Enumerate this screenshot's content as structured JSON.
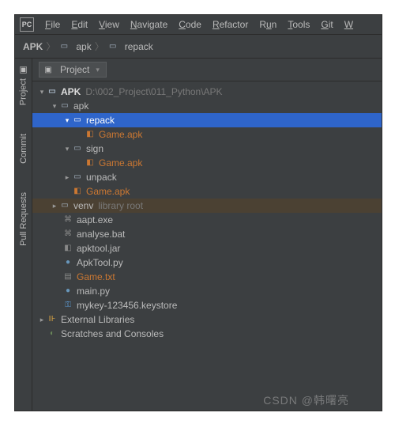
{
  "menu": {
    "items": [
      "File",
      "Edit",
      "View",
      "Navigate",
      "Code",
      "Refactor",
      "Run",
      "Tools",
      "Git",
      "W"
    ]
  },
  "logo": "PC",
  "breadcrumb": {
    "root": "APK",
    "items": [
      "apk",
      "repack"
    ]
  },
  "panel": {
    "title": "Project"
  },
  "toolstrip": {
    "tabs": [
      "Project",
      "Commit",
      "Pull Requests"
    ]
  },
  "tree": {
    "root": {
      "name": "APK",
      "path": "D:\\002_Project\\011_Python\\APK"
    },
    "apk": "apk",
    "repack": "repack",
    "repack_game": "Game.apk",
    "sign": "sign",
    "sign_game": "Game.apk",
    "unpack": "unpack",
    "unpack_game": "Game.apk",
    "venv": "venv",
    "venv_hint": "library root",
    "files": {
      "aapt": "aapt.exe",
      "analyse": "analyse.bat",
      "apktooljar": "apktool.jar",
      "apktoolpy": "ApkTool.py",
      "gametxt": "Game.txt",
      "mainpy": "main.py",
      "keystore": "mykey-123456.keystore"
    },
    "ext": "External Libraries",
    "scratch": "Scratches and Consoles"
  },
  "watermark": "CSDN @韩曙亮"
}
